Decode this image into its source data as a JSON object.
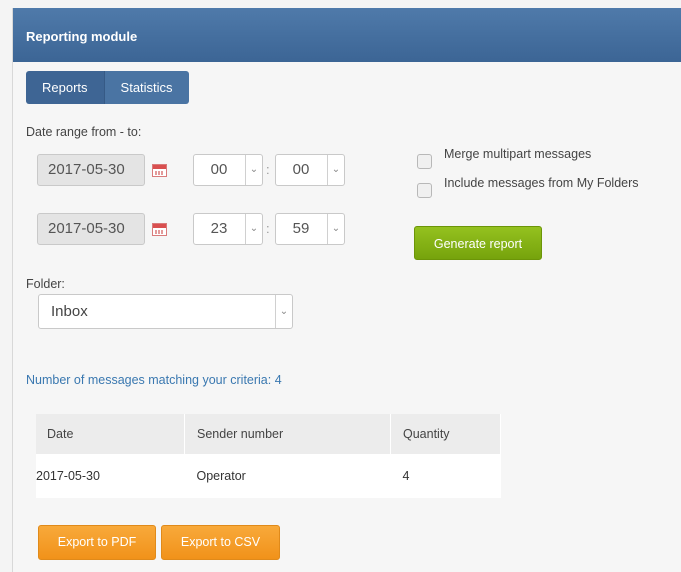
{
  "header": {
    "title": "Reporting module"
  },
  "tabs": [
    {
      "label": "Reports"
    },
    {
      "label": "Statistics"
    }
  ],
  "date_range": {
    "label": "Date range from - to:",
    "from": {
      "date": "2017-05-30",
      "hour": "00",
      "minute": "00"
    },
    "to": {
      "date": "2017-05-30",
      "hour": "23",
      "minute": "59"
    },
    "separator": ":"
  },
  "options": {
    "merge_label": "Merge multipart messages",
    "include_label": "Include messages from My Folders",
    "generate_label": "Generate report"
  },
  "folder": {
    "label": "Folder:",
    "selected": "Inbox"
  },
  "results": {
    "matching_text": "Number of messages matching your criteria: 4",
    "columns": [
      "Date",
      "Sender number",
      "Quantity"
    ],
    "rows": [
      [
        "2017-05-30",
        "Operator",
        "4"
      ]
    ]
  },
  "export": {
    "pdf_label": "Export to PDF",
    "csv_label": "Export to CSV"
  },
  "colors": {
    "header": "#4a74a3",
    "generate": "#86b316",
    "export": "#f4a02a",
    "link": "#3a78b0"
  }
}
